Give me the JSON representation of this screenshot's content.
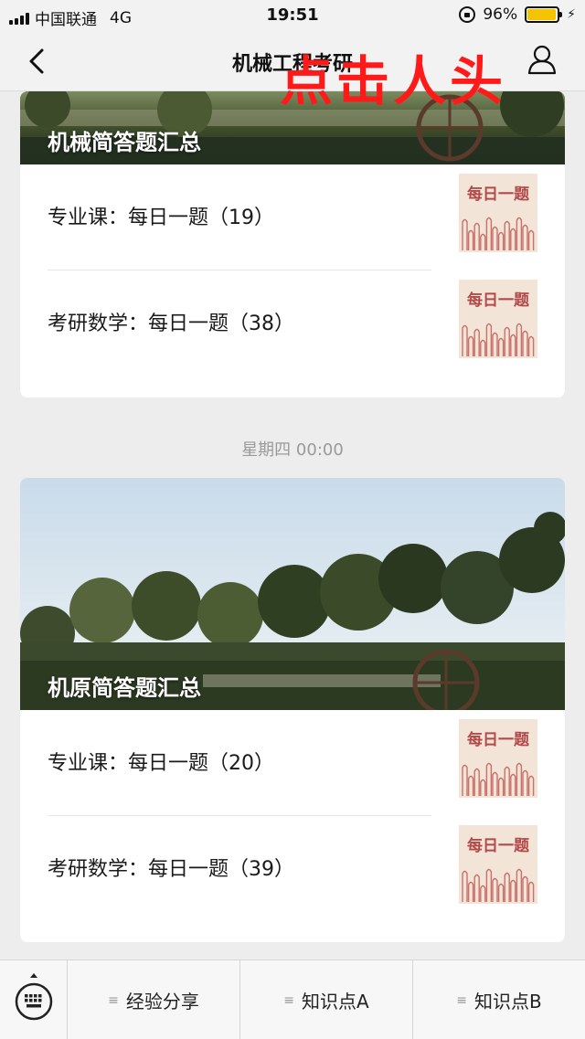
{
  "status_bar": {
    "carrier": "中国联通",
    "network": "4G",
    "time": "19:51",
    "battery": "96%",
    "battery_level": 0.96
  },
  "nav": {
    "title": "机械工程考研",
    "back_icon": "chevron-left-icon",
    "user_icon": "user-icon"
  },
  "overlay": {
    "text": "点击人头",
    "color": "#ff1a1a"
  },
  "cards": [
    {
      "banner_title": "机械简答题汇总",
      "articles": [
        {
          "title": "专业课：每日一题（19）",
          "thumb_text": "每日一题"
        },
        {
          "title": "考研数学：每日一题（38）",
          "thumb_text": "每日一题"
        }
      ]
    },
    {
      "timestamp": "星期四 00:00",
      "banner_title": "机原简答题汇总",
      "articles": [
        {
          "title": "专业课：每日一题（20）",
          "thumb_text": "每日一题"
        },
        {
          "title": "考研数学：每日一题（39）",
          "thumb_text": "每日一题"
        }
      ]
    }
  ],
  "bottom_menu": {
    "keyboard_icon": "keyboard-icon",
    "items": [
      {
        "label": "经验分享",
        "icon": "menu-lines-icon"
      },
      {
        "label": "知识点A",
        "icon": "menu-lines-icon"
      },
      {
        "label": "知识点B",
        "icon": "menu-lines-icon"
      }
    ]
  }
}
